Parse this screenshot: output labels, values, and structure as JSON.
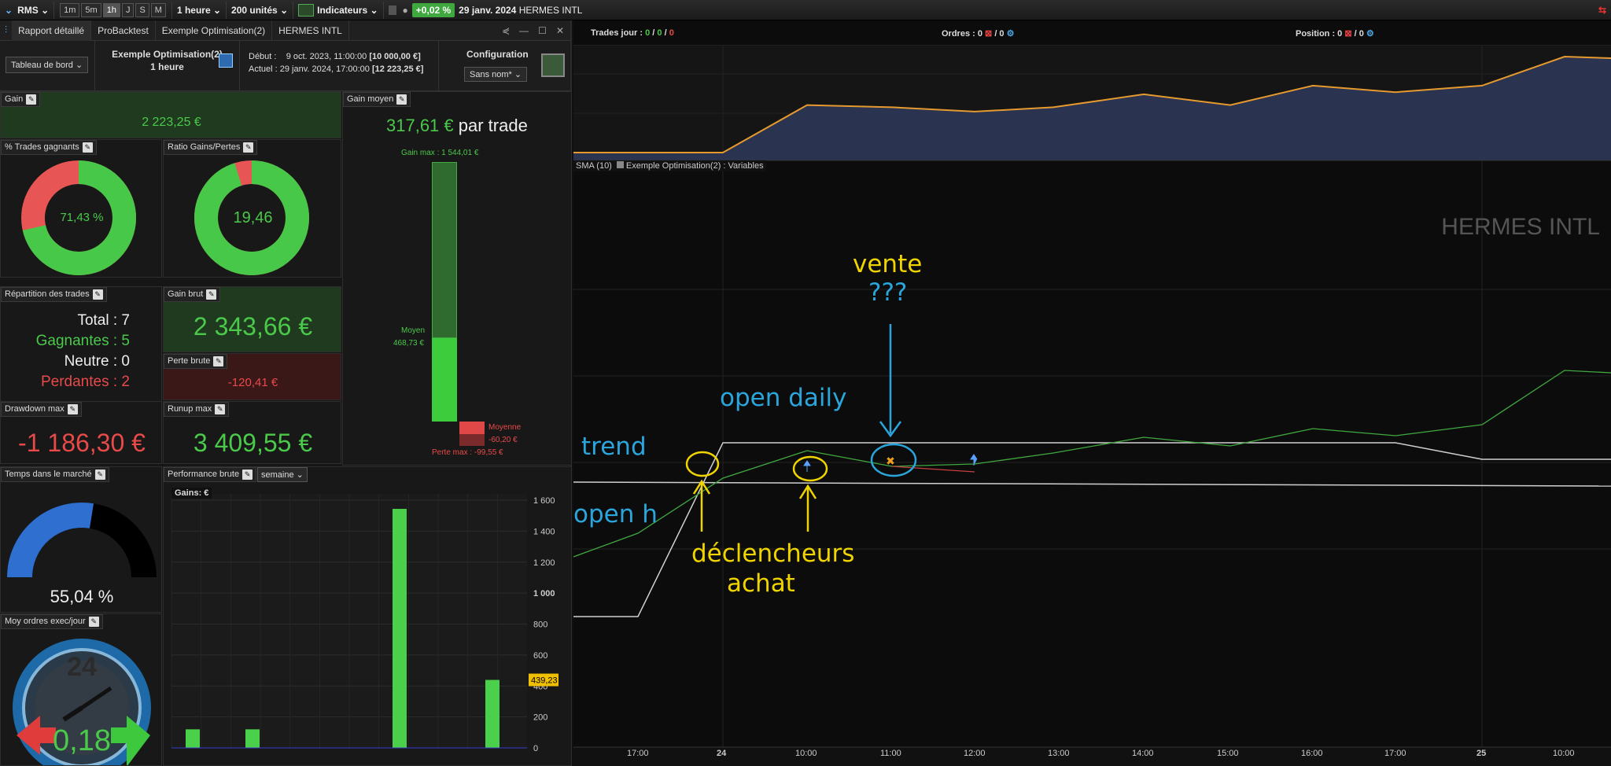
{
  "toolbar": {
    "rms": "RMS",
    "timeframes": [
      "1m",
      "5m",
      "1h",
      "J",
      "S",
      "M"
    ],
    "period": "1 heure",
    "units": "200 unités",
    "indicators": "Indicateurs",
    "change": "+0,02 %",
    "date": "29 janv. 2024",
    "instrument": "HERMES INTL"
  },
  "tabs": [
    "Rapport détaillé",
    "ProBacktest",
    "Exemple Optimisation(2)",
    "HERMES INTL"
  ],
  "header": {
    "view_select": "Tableau de bord",
    "strategy_name": "Exemple Optimisation(2)",
    "strategy_period": "1 heure",
    "start_label": "Début :",
    "start_value": "9 oct. 2023, 11:00:00",
    "start_capital": "[10 000,00 €]",
    "current_label": "Actuel :",
    "current_value": "29 janv. 2024, 17:00:00",
    "current_capital": "[12 223,25 €]",
    "config_label": "Configuration",
    "config_select": "Sans nom*"
  },
  "gain": {
    "title": "Gain",
    "value": "2 223,25 €"
  },
  "gain_moyen": {
    "title": "Gain moyen",
    "value": "317,61 €",
    "suffix": "par trade",
    "max_label": "Gain max : 1 544,01 €",
    "avg_label": "Moyen",
    "avg_value": "468,73 €",
    "neg_avg_label": "Moyenne",
    "neg_avg_value": "-60,20 €",
    "neg_max_label": "Perte max : -99,55 €"
  },
  "trades_gagnants": {
    "title": "% Trades gagnants",
    "value": "71,43 %",
    "fraction": 0.7143
  },
  "ratio": {
    "title": "Ratio Gains/Pertes",
    "value": "19,46",
    "fraction": 0.951
  },
  "repartition": {
    "title": "Répartition des trades",
    "total": "Total : 7",
    "gagnantes": "Gagnantes : 5",
    "neutre": "Neutre : 0",
    "perdantes": "Perdantes : 2"
  },
  "gain_brut": {
    "title": "Gain brut",
    "value": "2 343,66 €"
  },
  "perte_brute": {
    "title": "Perte brute",
    "value": "-120,41 €"
  },
  "drawdown": {
    "title": "Drawdown max",
    "value": "-1 186,30 €"
  },
  "runup": {
    "title": "Runup max",
    "value": "3 409,55 €"
  },
  "temps_marche": {
    "title": "Temps dans le marché",
    "value": "55,04 %",
    "fraction": 0.5504
  },
  "moy_ordres": {
    "title": "Moy ordres exec/jour",
    "value": "0,18",
    "dial": "24"
  },
  "perf_brute": {
    "title": "Performance brute",
    "select": "semaine",
    "label": "Gains: €",
    "highlight": "439,23"
  },
  "chart_data": [
    {
      "type": "bar",
      "title": "Gains: €",
      "yticks": [
        "1 600",
        "1 400",
        "1 200",
        "1 000",
        "800",
        "600",
        "400",
        "200",
        "0"
      ],
      "ylim": [
        0,
        1600
      ],
      "values": [
        120,
        120,
        0,
        0,
        1544,
        0,
        439.23
      ],
      "highlight_label": "439,23"
    },
    {
      "type": "area",
      "series": [
        {
          "values": [
            0,
            0,
            1100,
            1050,
            950,
            1050,
            1350,
            1100,
            1550,
            1400,
            1550,
            2223
          ]
        }
      ]
    }
  ],
  "right": {
    "trades_jour_label": "Trades jour :",
    "trades_jour_vals": [
      "0",
      "0",
      "0"
    ],
    "ordres_label": "Ordres : 0",
    "ordres_vals": "/ 0",
    "position_label": "Position : 0",
    "position_vals": "/ 0",
    "legend_sma": "SMA (10)",
    "legend_var": "Exemple Optimisation(2) : Variables",
    "watermark": "HERMES INTL",
    "xticks": [
      "17:00",
      "24",
      "10:00",
      "11:00",
      "12:00",
      "13:00",
      "14:00",
      "15:00",
      "16:00",
      "17:00",
      "25",
      "10:00"
    ]
  },
  "annotations": {
    "vente": "vente",
    "qmarks": "???",
    "open_daily": "open daily",
    "trend": "trend",
    "open_h": "open h",
    "declencheurs": "déclencheurs",
    "achat": "achat"
  }
}
